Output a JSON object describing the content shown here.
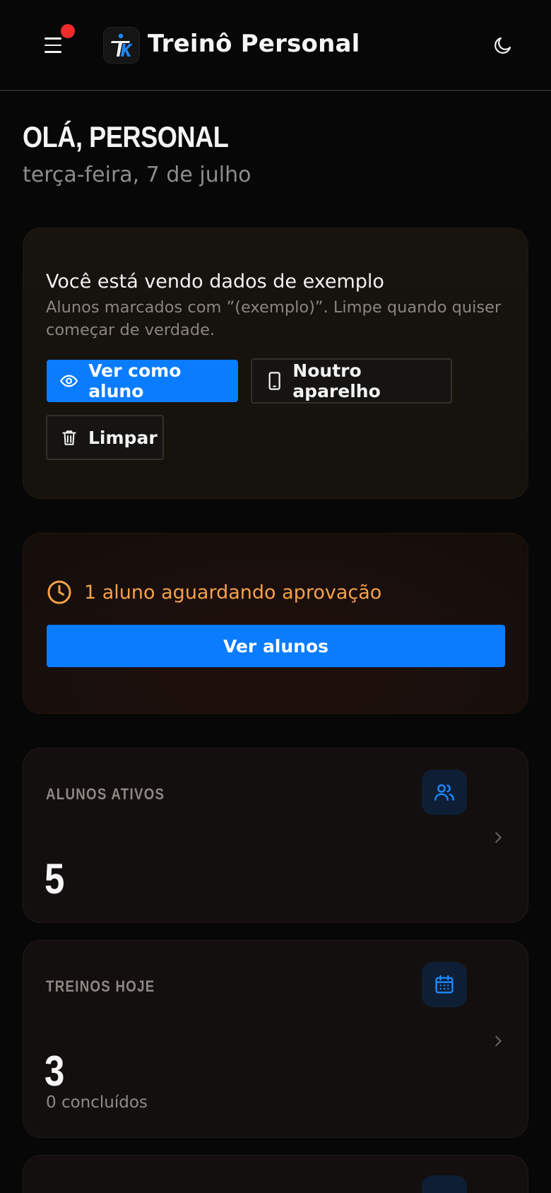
{
  "header": {
    "app_title": "Treinô Personal",
    "menu_icon": "menu-icon",
    "theme_icon": "moon-icon",
    "notification_color": "#ef2b2b"
  },
  "greeting": {
    "title": "OLÁ, PERSONAL",
    "date": "terça-feira, 7 de julho"
  },
  "demo_card": {
    "title": "Você está vendo dados de exemplo",
    "description": "Alunos marcados com ”(exemplo)”. Limpe quando quiser começar de verdade.",
    "view_as_student_label": "Ver como aluno",
    "other_device_label": "Noutro aparelho",
    "clear_label": "Limpar"
  },
  "pending_card": {
    "text": "1 aluno aguardando aprovação",
    "button_label": "Ver alunos",
    "accent_color": "#f5a14a"
  },
  "stats": [
    {
      "label": "ALUNOS ATIVOS",
      "value": "5",
      "sub": "",
      "icon": "users-icon"
    },
    {
      "label": "TREINOS HOJE",
      "value": "3",
      "sub": "0 concluídos",
      "icon": "calendar-icon"
    }
  ],
  "colors": {
    "primary": "#0a7cff",
    "background": "#070707",
    "icon_tile": "#0e1f35"
  }
}
